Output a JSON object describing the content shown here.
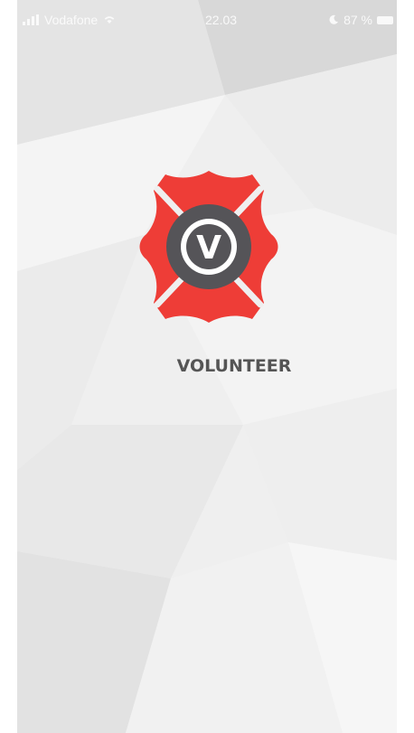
{
  "status_bar": {
    "carrier": "Vodafone",
    "time": "22.03",
    "battery_percent": "87 %",
    "icons": [
      "signal-icon",
      "wifi-icon",
      "moon-icon",
      "battery-icon"
    ]
  },
  "splash": {
    "app_name": "VOLUNTEER",
    "logo_letter": "V",
    "logo_icon": "maltese-cross-logo-icon",
    "colors": {
      "cross": "#ee3d37",
      "ring": "#555458",
      "text": "#555555",
      "background": "#efefef"
    }
  }
}
